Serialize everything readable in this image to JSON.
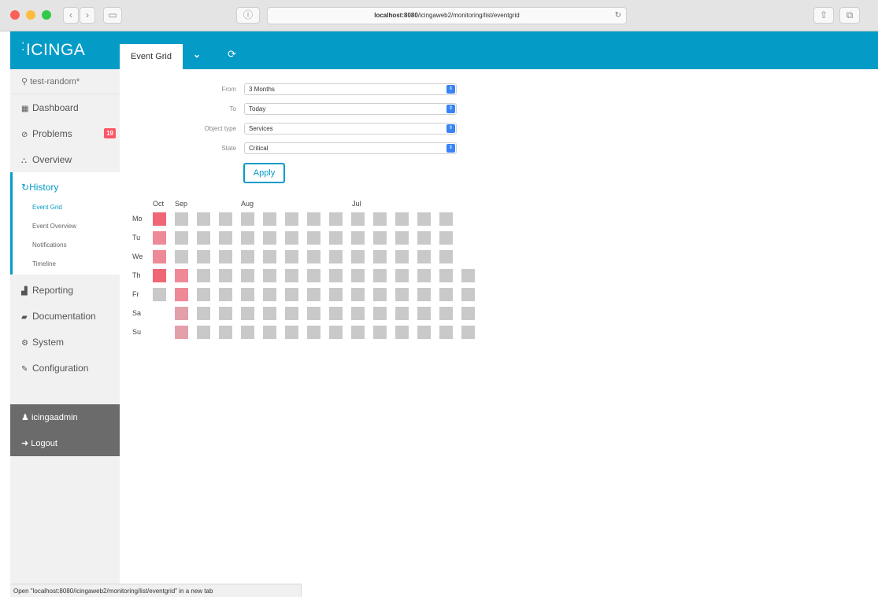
{
  "browser": {
    "url_host": "localhost:8080",
    "url_path": "/icingaweb2/monitoring/list/eventgrid",
    "status_text": "Open \"localhost:8080/icingaweb2/monitoring/list/eventgrid\" in a new tab",
    "traffic_colors": [
      "#fc605b",
      "#fdbc40",
      "#34c84a"
    ]
  },
  "header": {
    "logo_text": "icinga",
    "active_tab": "Event Grid",
    "accent_color": "#049bc7"
  },
  "sidebar": {
    "search_text": "test-random*",
    "items": [
      {
        "label": "Dashboard",
        "icon": "dashboard-icon",
        "glyph": "▦"
      },
      {
        "label": "Problems",
        "icon": "problems-icon",
        "glyph": "⊘",
        "badge": "19"
      },
      {
        "label": "Overview",
        "icon": "overview-icon",
        "glyph": "⛬"
      }
    ],
    "history": {
      "label": "History",
      "icon": "history-icon",
      "glyph": "↻",
      "subitems": [
        "Event Grid",
        "Event Overview",
        "Notifications",
        "Timeline"
      ],
      "active_subitem": "Event Grid"
    },
    "items_after": [
      {
        "label": "Reporting",
        "icon": "reporting-icon",
        "glyph": "▟"
      },
      {
        "label": "Documentation",
        "icon": "documentation-icon",
        "glyph": "▰"
      },
      {
        "label": "System",
        "icon": "system-icon",
        "glyph": "⚙"
      },
      {
        "label": "Configuration",
        "icon": "configuration-icon",
        "glyph": "✎"
      }
    ],
    "user": {
      "name": "icingaadmin",
      "logout": "Logout"
    }
  },
  "form": {
    "fields": [
      {
        "label": "From",
        "value": "3 Months"
      },
      {
        "label": "To",
        "value": "Today"
      },
      {
        "label": "Object type",
        "value": "Services"
      },
      {
        "label": "State",
        "value": "Critical"
      }
    ],
    "apply_label": "Apply"
  },
  "grid": {
    "months": [
      "Oct",
      "Sep",
      "Aug",
      "Jul"
    ],
    "days": [
      "Mo",
      "Tu",
      "We",
      "Th",
      "Fr",
      "Sa",
      "Su"
    ],
    "colors": {
      "none": "#c9c9c9",
      "high": "#f06674",
      "mid": "#ee8a97",
      "low": "#e3a0ab"
    },
    "columns": [
      [
        "high",
        "mid",
        "mid",
        "high",
        "none",
        null,
        null
      ],
      [
        "none",
        "none",
        "none",
        "mid",
        "mid",
        "low",
        "low"
      ],
      [
        "none",
        "none",
        "none",
        "none",
        "none",
        "none",
        "none"
      ],
      [
        "none",
        "none",
        "none",
        "none",
        "none",
        "none",
        "none"
      ],
      [
        "none",
        "none",
        "none",
        "none",
        "none",
        "none",
        "none"
      ],
      [
        "none",
        "none",
        "none",
        "none",
        "none",
        "none",
        "none"
      ],
      [
        "none",
        "none",
        "none",
        "none",
        "none",
        "none",
        "none"
      ],
      [
        "none",
        "none",
        "none",
        "none",
        "none",
        "none",
        "none"
      ],
      [
        "none",
        "none",
        "none",
        "none",
        "none",
        "none",
        "none"
      ],
      [
        "none",
        "none",
        "none",
        "none",
        "none",
        "none",
        "none"
      ],
      [
        "none",
        "none",
        "none",
        "none",
        "none",
        "none",
        "none"
      ],
      [
        "none",
        "none",
        "none",
        "none",
        "none",
        "none",
        "none"
      ],
      [
        "none",
        "none",
        "none",
        "none",
        "none",
        "none",
        "none"
      ],
      [
        "none",
        "none",
        "none",
        "none",
        "none",
        "none",
        "none"
      ],
      [
        null,
        null,
        null,
        "none",
        "none",
        "none",
        "none"
      ]
    ]
  }
}
